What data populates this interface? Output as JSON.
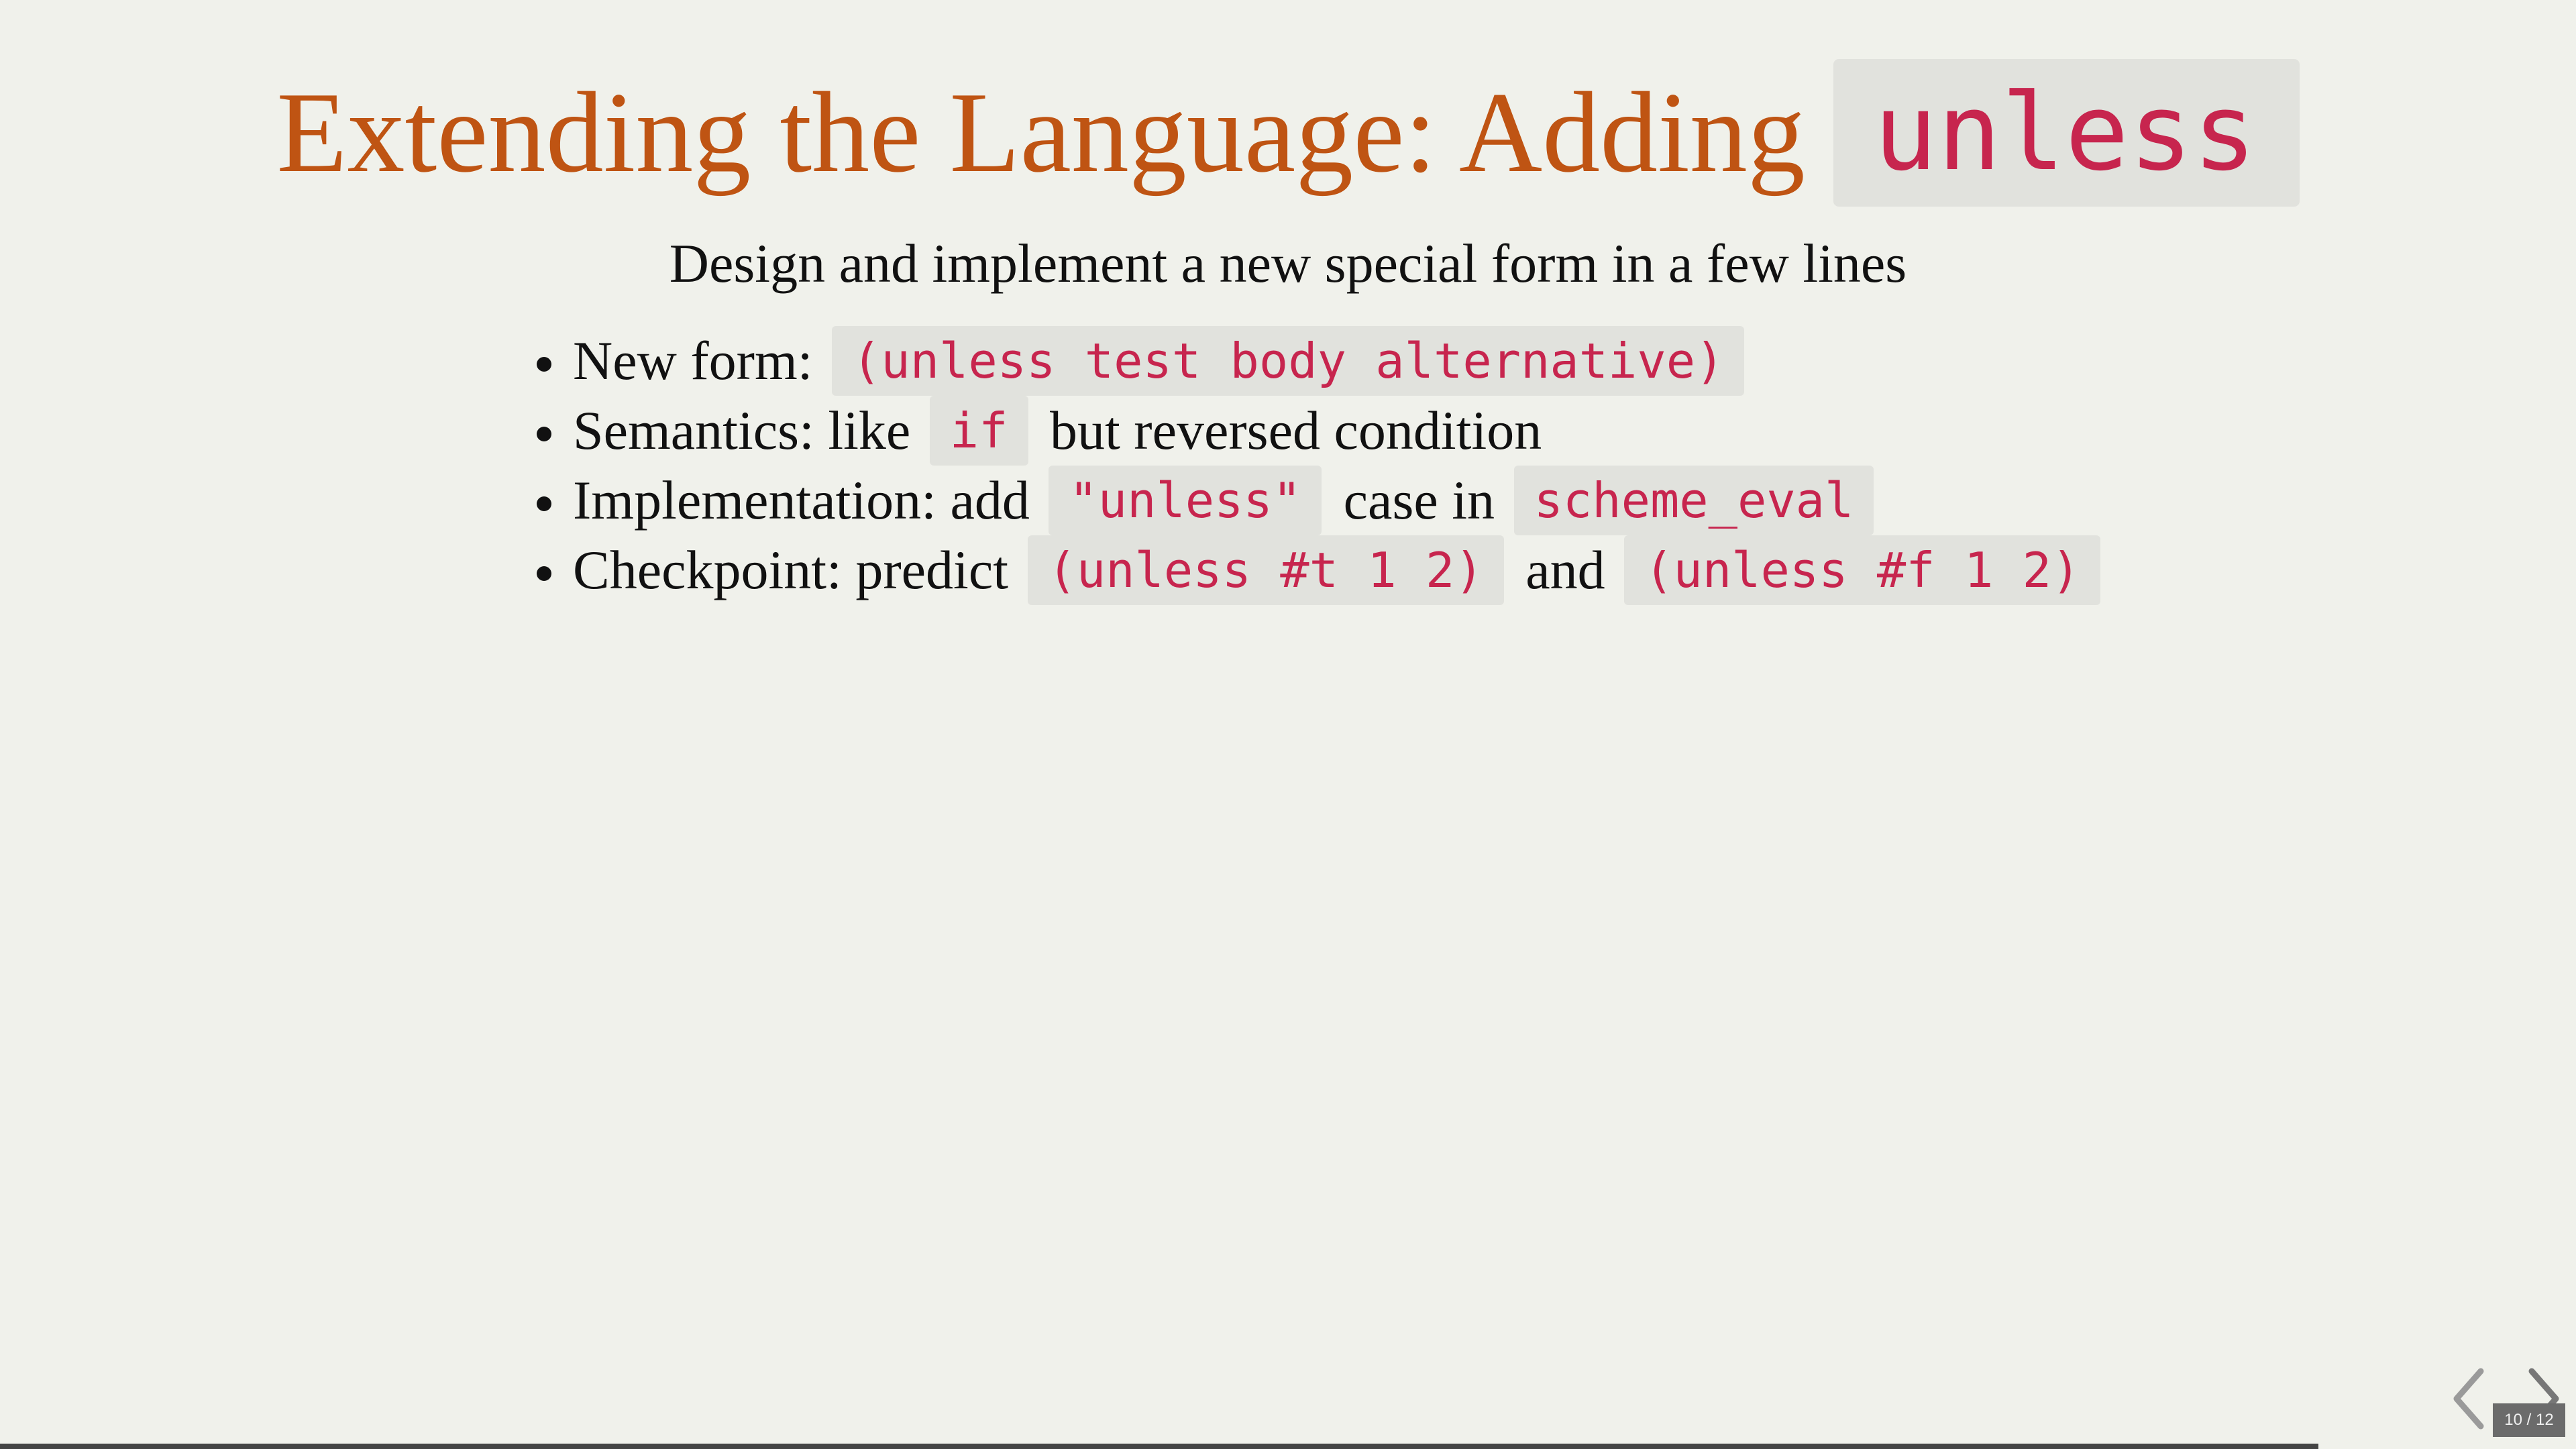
{
  "slide": {
    "title_text": "Extending the Language: Adding",
    "title_code": "unless",
    "subtitle": "Design and implement a new special form in a few lines",
    "bullets": [
      {
        "parts": [
          {
            "type": "text",
            "value": "New form: "
          },
          {
            "type": "code",
            "value": "(unless test body alternative)"
          }
        ]
      },
      {
        "parts": [
          {
            "type": "text",
            "value": "Semantics: like "
          },
          {
            "type": "code",
            "value": "if"
          },
          {
            "type": "text",
            "value": " but reversed condition"
          }
        ]
      },
      {
        "parts": [
          {
            "type": "text",
            "value": "Implementation: add "
          },
          {
            "type": "code",
            "value": "\"unless\""
          },
          {
            "type": "text",
            "value": " case in "
          },
          {
            "type": "code",
            "value": "scheme_eval"
          }
        ]
      },
      {
        "parts": [
          {
            "type": "text",
            "value": "Checkpoint: predict "
          },
          {
            "type": "code",
            "value": "(unless #t 1 2)"
          },
          {
            "type": "text",
            "value": " and "
          },
          {
            "type": "code",
            "value": "(unless #f 1 2)"
          }
        ]
      }
    ]
  },
  "navigation": {
    "prev_icon": "chevron-left-icon",
    "next_icon": "chevron-right-icon",
    "current": "10",
    "separator": "/",
    "total": "12",
    "progress": 0.9
  },
  "colors": {
    "background": "#f0f1eb",
    "title": "#bf5413",
    "code": "#c7254e",
    "code_background": "#e1e2dd"
  }
}
